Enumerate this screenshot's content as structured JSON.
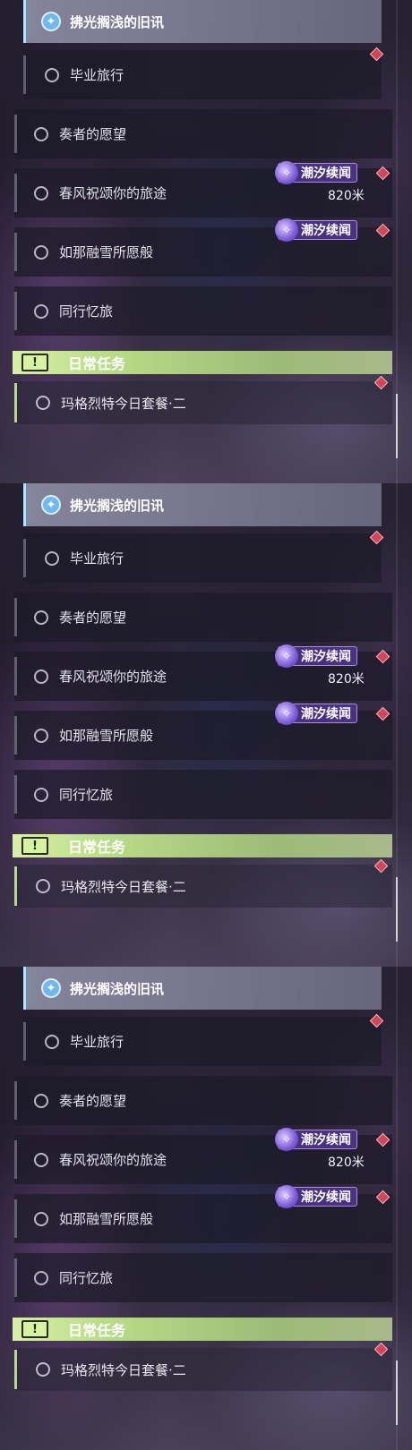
{
  "panels": [
    {
      "pinned_quest": {
        "title": "拂光搁浅的旧讯",
        "icon": "navigation-star-icon"
      },
      "quests": [
        {
          "label": "毕业旅行"
        },
        {
          "label": "奏者的愿望"
        },
        {
          "label": "春风祝颂你的旅途",
          "tag": "潮汐续闻",
          "distance": "820米"
        },
        {
          "label": "如那融雪所愿般",
          "tag": "潮汐续闻"
        },
        {
          "label": "同行忆旅"
        }
      ],
      "daily": {
        "header": "日常任务",
        "header_icon": "exclamation-icon",
        "quest": "玛格烈特今日套餐·二"
      }
    },
    {
      "pinned_quest": {
        "title": "拂光搁浅的旧讯",
        "icon": "navigation-star-icon"
      },
      "quests": [
        {
          "label": "毕业旅行"
        },
        {
          "label": "奏者的愿望"
        },
        {
          "label": "春风祝颂你的旅途",
          "tag": "潮汐续闻",
          "distance": "820米"
        },
        {
          "label": "如那融雪所愿般",
          "tag": "潮汐续闻"
        },
        {
          "label": "同行忆旅"
        }
      ],
      "daily": {
        "header": "日常任务",
        "header_icon": "exclamation-icon",
        "quest": "玛格烈特今日套餐·二"
      }
    },
    {
      "pinned_quest": {
        "title": "拂光搁浅的旧讯",
        "icon": "navigation-star-icon"
      },
      "quests": [
        {
          "label": "毕业旅行"
        },
        {
          "label": "奏者的愿望"
        },
        {
          "label": "春风祝颂你的旅途",
          "tag": "潮汐续闻",
          "distance": "820米"
        },
        {
          "label": "如那融雪所愿般",
          "tag": "潮汐续闻"
        },
        {
          "label": "同行忆旅"
        }
      ],
      "daily": {
        "header": "日常任务",
        "header_icon": "exclamation-icon",
        "quest": "玛格烈特今日套餐·二"
      }
    }
  ],
  "colors": {
    "tag_purple": "#4c348c",
    "daily_green": "#b9dc87",
    "tracker_marker_red": "#d4455a",
    "pinned_accent": "#a6e8ff"
  }
}
